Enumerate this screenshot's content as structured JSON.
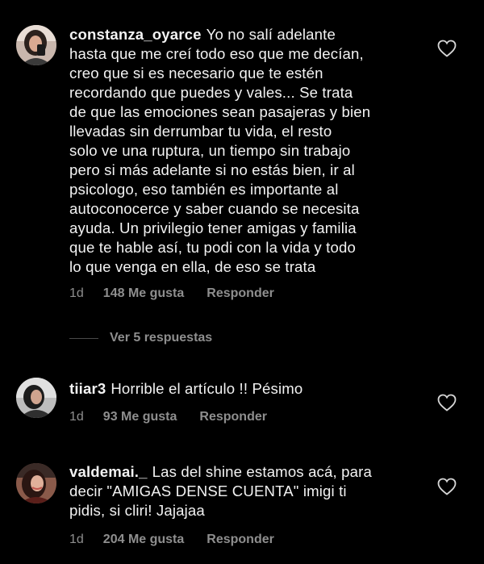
{
  "colors": {
    "background": "#000000",
    "text": "#f2f2f2",
    "muted": "#8e8e8e",
    "divider": "#4a4a4a"
  },
  "comments": [
    {
      "username": "constanza_oyarce",
      "lines": [
        "Yo no salí adelante",
        "hasta que me creí todo eso que me decían,",
        "creo que si es necesario que te estén",
        "recordando que puedes y vales... Se trata",
        "de que las emociones sean pasajeras y bien",
        "llevadas sin  derrumbar tu vida, el resto",
        "solo ve una ruptura, un tiempo sin trabajo",
        "pero si más adelante si no estás bien, ir al",
        "psicologo, eso también es importante al",
        "autoconocerce y saber cuando se necesita",
        "ayuda. Un privilegio tener amigas y familia",
        "que te hable así, tu podi con la vida y todo",
        "lo que venga en ella, de eso se trata"
      ],
      "time": "1d",
      "likes": "148 Me gusta",
      "reply_label": "Responder",
      "like_icon": "heart-outline-icon"
    },
    {
      "username": "tiiar3",
      "lines": [
        "Horrible el artículo !! Pésimo"
      ],
      "time": "1d",
      "likes": "93 Me gusta",
      "reply_label": "Responder",
      "like_icon": "heart-outline-icon"
    },
    {
      "username": "valdemai._",
      "lines": [
        "Las del shine estamos acá, para",
        "decir \"AMIGAS DENSE CUENTA\" imigi ti",
        "pidis, si cliri! Jajajaa"
      ],
      "time": "1d",
      "likes": "204 Me gusta",
      "reply_label": "Responder",
      "like_icon": "heart-outline-icon"
    }
  ],
  "view_replies": "Ver 5 respuestas"
}
